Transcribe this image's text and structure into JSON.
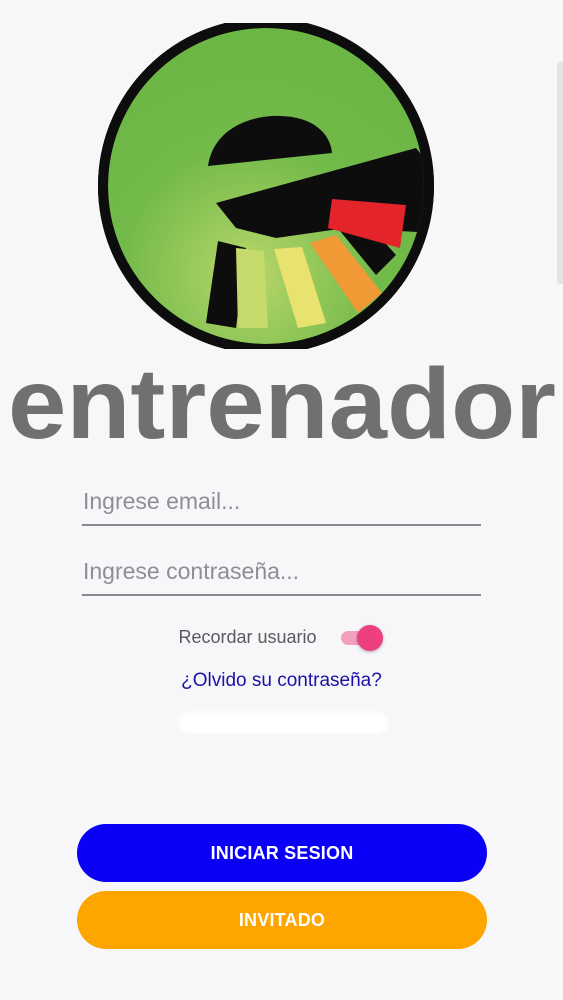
{
  "brand": {
    "name": "entrenador",
    "logo_letter": "e"
  },
  "login": {
    "email_placeholder": "Ingrese email...",
    "password_placeholder": "Ingrese contraseña...",
    "remember_label": "Recordar usuario",
    "remember_enabled": true,
    "forgot_password": "¿Olvido su contraseña?"
  },
  "actions": {
    "login_label": "INICIAR SESION",
    "guest_label": "INVITADO"
  },
  "colors": {
    "login_button": "#0a00f5",
    "guest_button": "#fea500",
    "toggle_on": "#ee3f81",
    "link": "#1a12a6",
    "logo_green": "#72ba4a",
    "wordmark_gray": "#707070"
  }
}
